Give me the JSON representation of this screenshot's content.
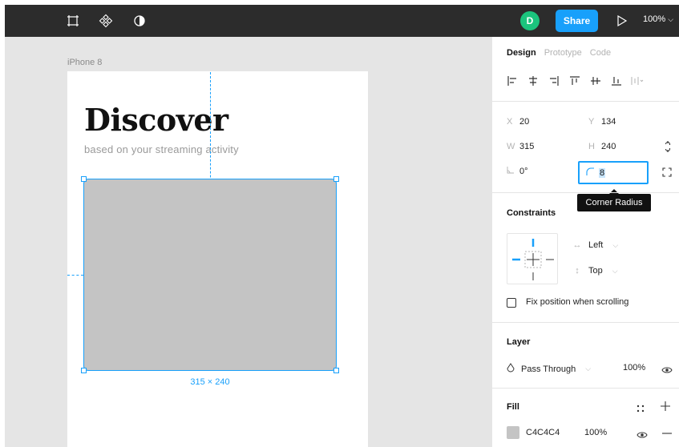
{
  "toolbar": {
    "icons": [
      "frame-tool-icon",
      "component-icon",
      "contrast-icon"
    ],
    "avatar_initial": "D",
    "share_label": "Share",
    "play_icon": "play-icon",
    "zoom_label": "100%"
  },
  "canvas": {
    "frame_label": "iPhone 8",
    "heading": "Discover",
    "subheading": "based on your streaming activity",
    "size_label": "315 × 240"
  },
  "panel": {
    "tabs": [
      {
        "label": "Design",
        "active": true
      },
      {
        "label": "Prototype",
        "active": false
      },
      {
        "label": "Code",
        "active": false
      }
    ],
    "align_icons": [
      "align-left-icon",
      "align-horizontal-center-icon",
      "align-right-icon",
      "align-top-icon",
      "align-vertical-center-icon",
      "align-bottom-icon",
      "distribute-icon"
    ],
    "props": {
      "x_label": "X",
      "x_value": "20",
      "y_label": "Y",
      "y_value": "134",
      "w_label": "W",
      "w_value": "315",
      "h_label": "H",
      "h_value": "240",
      "rotation_value": "0°",
      "radius_value": "8"
    },
    "tooltip": "Corner Radius",
    "constraints": {
      "title": "Constraints",
      "horizontal": "Left",
      "vertical": "Top",
      "fix_position_label": "Fix position when scrolling"
    },
    "layer": {
      "title": "Layer",
      "blend_mode": "Pass Through",
      "opacity": "100%"
    },
    "fill": {
      "title": "Fill",
      "hex": "C4C4C4",
      "opacity": "100%",
      "color": "#c4c4c4"
    }
  },
  "colors": {
    "accent": "#18a0fb",
    "avatar": "#1bc47d",
    "toolbar_bg": "#2c2c2c",
    "canvas_bg": "#e5e5e5"
  }
}
